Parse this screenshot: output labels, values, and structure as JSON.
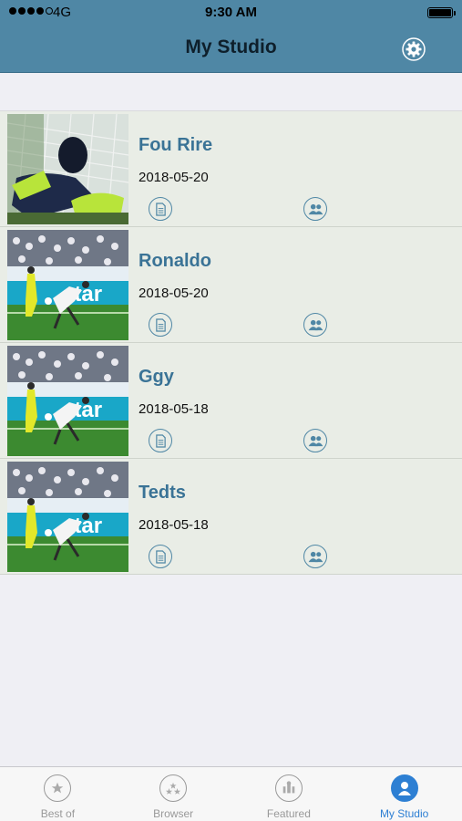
{
  "status_bar": {
    "network": "4G",
    "time": "9:30 AM"
  },
  "header": {
    "title": "My Studio",
    "settings_icon": "gear-icon"
  },
  "studio_items": [
    {
      "title": "Fou Rire",
      "date": "2018-05-20",
      "thumbnail": "goalkeeper-save"
    },
    {
      "title": "Ronaldo",
      "date": "2018-05-20",
      "thumbnail": "bicycle-kick"
    },
    {
      "title": "Ggy",
      "date": "2018-05-18",
      "thumbnail": "bicycle-kick"
    },
    {
      "title": "Tedts",
      "date": "2018-05-18",
      "thumbnail": "bicycle-kick"
    }
  ],
  "tabs": [
    {
      "label": "Best of",
      "icon": "best-of-icon",
      "active": false
    },
    {
      "label": "Browser",
      "icon": "browser-icon",
      "active": false
    },
    {
      "label": "Featured",
      "icon": "featured-icon",
      "active": false
    },
    {
      "label": "My Studio",
      "icon": "my-studio-icon",
      "active": true
    }
  ],
  "colors": {
    "header": "#4f87a5",
    "accent": "#3a7396",
    "active_tab": "#2d7fd3"
  }
}
